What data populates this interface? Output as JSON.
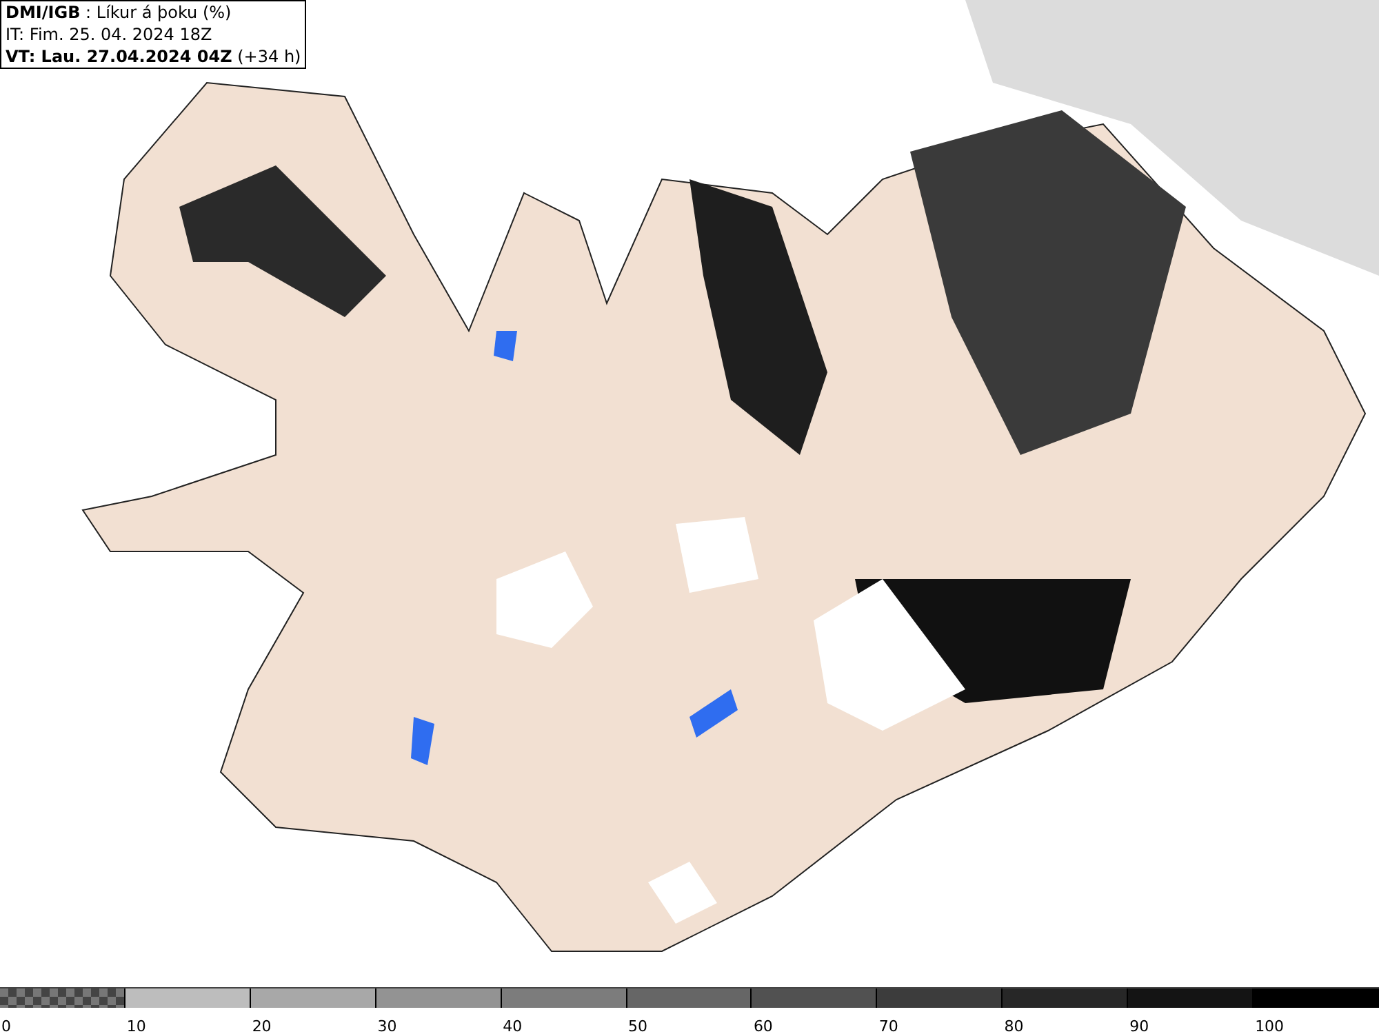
{
  "header": {
    "lines": [
      "**DMI/IGB** : Líkur á þoku (%)",
      "IT: Fim. 25. 04. 2024 18Z",
      "**VT: Lau. 27.04.2024 04Z** (+34 h)"
    ]
  },
  "legend": {
    "bins": [
      {
        "kind": "checker",
        "label": "0"
      },
      {
        "kind": "solid",
        "color": "#bdbdbd",
        "label": "10"
      },
      {
        "kind": "solid",
        "color": "#a8a8a8",
        "label": "20"
      },
      {
        "kind": "solid",
        "color": "#939393",
        "label": "30"
      },
      {
        "kind": "solid",
        "color": "#7c7c7c",
        "label": "40"
      },
      {
        "kind": "solid",
        "color": "#666666",
        "label": "50"
      },
      {
        "kind": "solid",
        "color": "#515151",
        "label": "60"
      },
      {
        "kind": "solid",
        "color": "#3c3c3c",
        "label": "70"
      },
      {
        "kind": "solid",
        "color": "#272727",
        "label": "80"
      },
      {
        "kind": "solid",
        "color": "#141414",
        "label": "90"
      },
      {
        "kind": "solid",
        "color": "#000000",
        "label": "100"
      }
    ]
  }
}
